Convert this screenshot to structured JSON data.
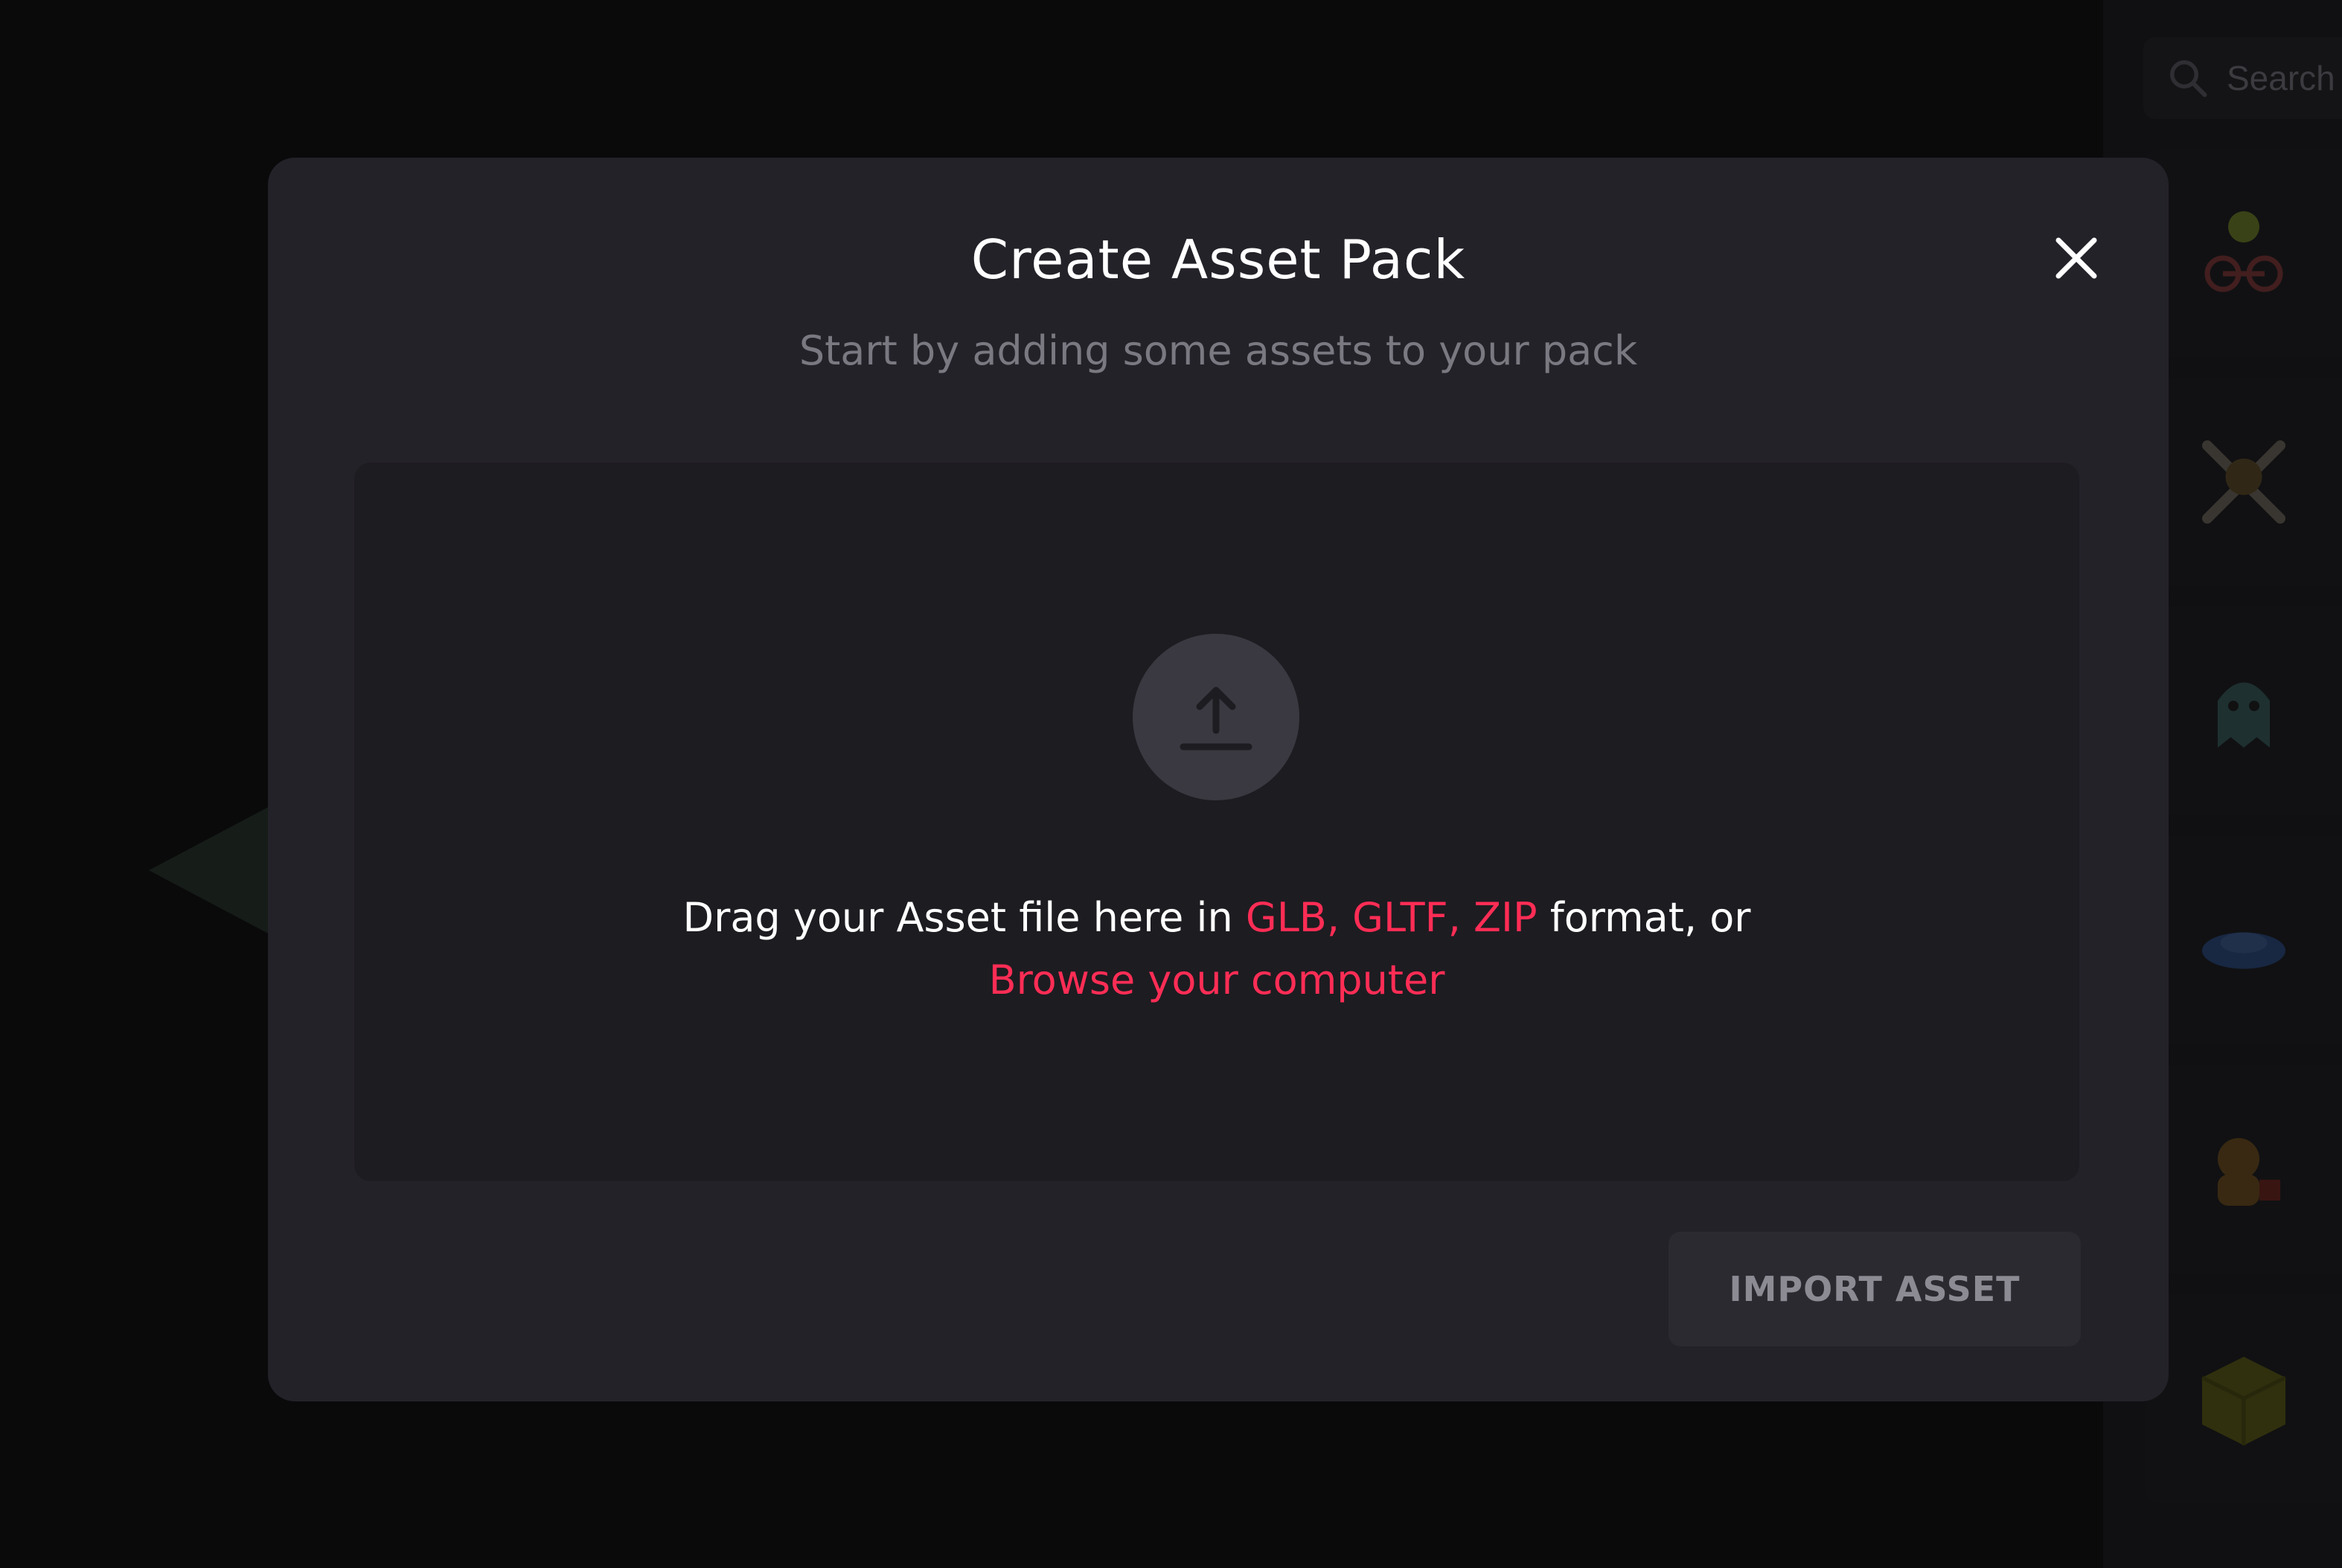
{
  "search": {
    "placeholder": "Search"
  },
  "asset_list": {
    "items": [
      {
        "icon": "flower-bicycle-thumbnail",
        "color": "#5a3b2a"
      },
      {
        "icon": "skull-crossbones-thumbnail",
        "color": "#6b5a3a"
      },
      {
        "icon": "ghost-thumbnail",
        "color": "#3b5a58"
      },
      {
        "icon": "boat-thumbnail",
        "color": "#2a4a7a"
      },
      {
        "icon": "cat-figure-thumbnail",
        "color": "#6a4a1a"
      },
      {
        "icon": "cube-crate-thumbnail",
        "color": "#6a6a10"
      }
    ]
  },
  "modal": {
    "title": "Create Asset Pack",
    "subtitle": "Start by adding some assets to your pack",
    "dropzone": {
      "text_before": "Drag your Asset file here in ",
      "formats": "GLB, GLTF, ZIP",
      "text_after": " format, or",
      "browse_label": "Browse your computer"
    },
    "import_button": "IMPORT ASSET"
  },
  "colors": {
    "accent": "#ff2d55",
    "modal_bg": "#242229",
    "dropzone_bg": "#1d1c21"
  }
}
